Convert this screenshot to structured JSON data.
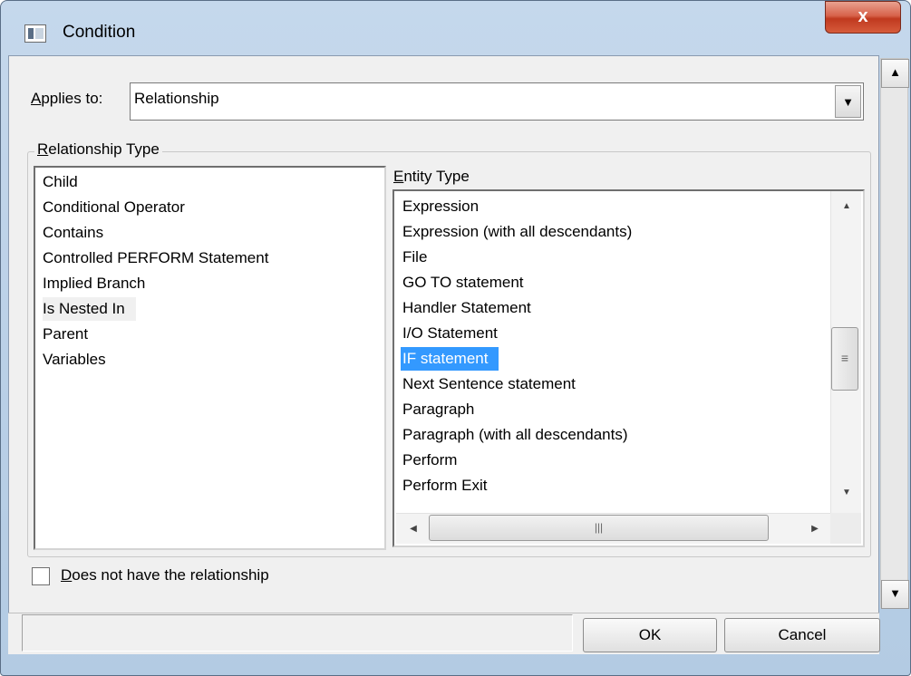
{
  "window": {
    "title": "Condition",
    "close_glyph": "x"
  },
  "applies_to": {
    "label": "Applies to:",
    "value": "Relationship"
  },
  "relationship_type": {
    "label": "Relationship Type",
    "items": [
      "Child",
      "Conditional Operator",
      "Contains",
      "Controlled PERFORM Statement",
      "Implied Branch",
      "Is Nested In",
      "Parent",
      "Variables"
    ],
    "selected_index": 5
  },
  "entity_type": {
    "label": "Entity Type",
    "items": [
      "Expression",
      "Expression (with all descendants)",
      "File",
      "GO TO statement",
      "Handler Statement",
      "I/O Statement",
      "IF statement",
      "Next Sentence statement",
      "Paragraph",
      "Paragraph (with all descendants)",
      "Perform",
      "Perform Exit"
    ],
    "selected_index": 6
  },
  "checkbox": {
    "label": "Does not have the relationship",
    "checked": false
  },
  "buttons": {
    "ok": "OK",
    "cancel": "Cancel"
  },
  "colors": {
    "selection": "#3399ff",
    "close_button": "#c0391f",
    "title_bar": "#b9cfe6"
  },
  "icons": [
    "app-icon",
    "close-icon",
    "dropdown-arrow-icon",
    "scroll-up-icon",
    "scroll-down-icon",
    "scroll-left-icon",
    "scroll-right-icon"
  ]
}
